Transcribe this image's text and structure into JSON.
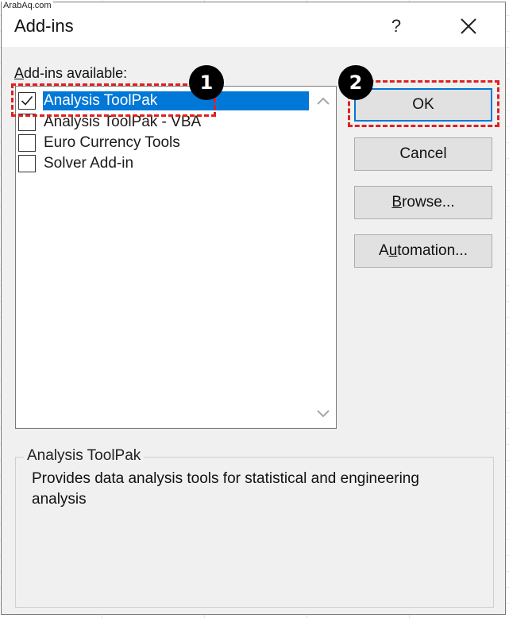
{
  "watermark": "ArabAq.com",
  "dialog": {
    "title": "Add-ins",
    "help_label": "?",
    "close_icon": "close-icon"
  },
  "list": {
    "label_prefix": "A",
    "label_rest": "dd-ins available:",
    "items": [
      {
        "label": "Analysis ToolPak",
        "checked": true,
        "selected": true
      },
      {
        "label": "Analysis ToolPak - VBA",
        "checked": false,
        "selected": false
      },
      {
        "label": "Euro Currency Tools",
        "checked": false,
        "selected": false
      },
      {
        "label": "Solver Add-in",
        "checked": false,
        "selected": false
      }
    ],
    "scroll_up_icon": "chevron-up-icon",
    "scroll_down_icon": "chevron-down-icon"
  },
  "buttons": {
    "ok": "OK",
    "cancel": "Cancel",
    "browse_prefix": "B",
    "browse_rest": "rowse...",
    "automation_prefix": "A",
    "automation_mnemonic": "u",
    "automation_rest": "tomation..."
  },
  "description": {
    "title": "Analysis ToolPak",
    "text": "Provides data analysis tools for statistical and engineering analysis"
  },
  "callouts": {
    "step1": "1",
    "step2": "2",
    "color": "#e02020"
  },
  "colors": {
    "selection": "#0078d7",
    "dialog_bg": "#f0f0f0",
    "button_bg": "#e1e1e1"
  }
}
